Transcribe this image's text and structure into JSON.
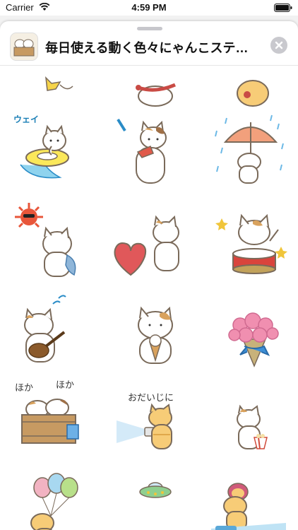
{
  "status_bar": {
    "carrier": "Carrier",
    "time": "4:59 PM"
  },
  "header": {
    "title": "毎日使える動く色々にゃんこステ…"
  },
  "stickers": [
    {
      "name": "partial-top-left"
    },
    {
      "name": "partial-top-middle"
    },
    {
      "name": "partial-top-right"
    },
    {
      "name": "swim-ring-cat",
      "text": "ウェイ"
    },
    {
      "name": "water-gun-cat"
    },
    {
      "name": "umbrella-cat"
    },
    {
      "name": "sun-sunglasses-cat"
    },
    {
      "name": "heart-cat"
    },
    {
      "name": "drum-cat"
    },
    {
      "name": "ukulele-cat"
    },
    {
      "name": "ice-cream-cat"
    },
    {
      "name": "flower-bouquet"
    },
    {
      "name": "bath-cats",
      "text_left": "ほか",
      "text_right": "ほか"
    },
    {
      "name": "flashlight-cat",
      "text": "おだいじに"
    },
    {
      "name": "popcorn-cat"
    },
    {
      "name": "balloons-cat"
    },
    {
      "name": "ufo"
    },
    {
      "name": "ufo-beam-cat"
    }
  ],
  "colors": {
    "outline": "#7a6a5a",
    "cat_white": "#ffffff",
    "cat_orange": "#f7cc77",
    "accent_blue": "#2a8cc7"
  }
}
